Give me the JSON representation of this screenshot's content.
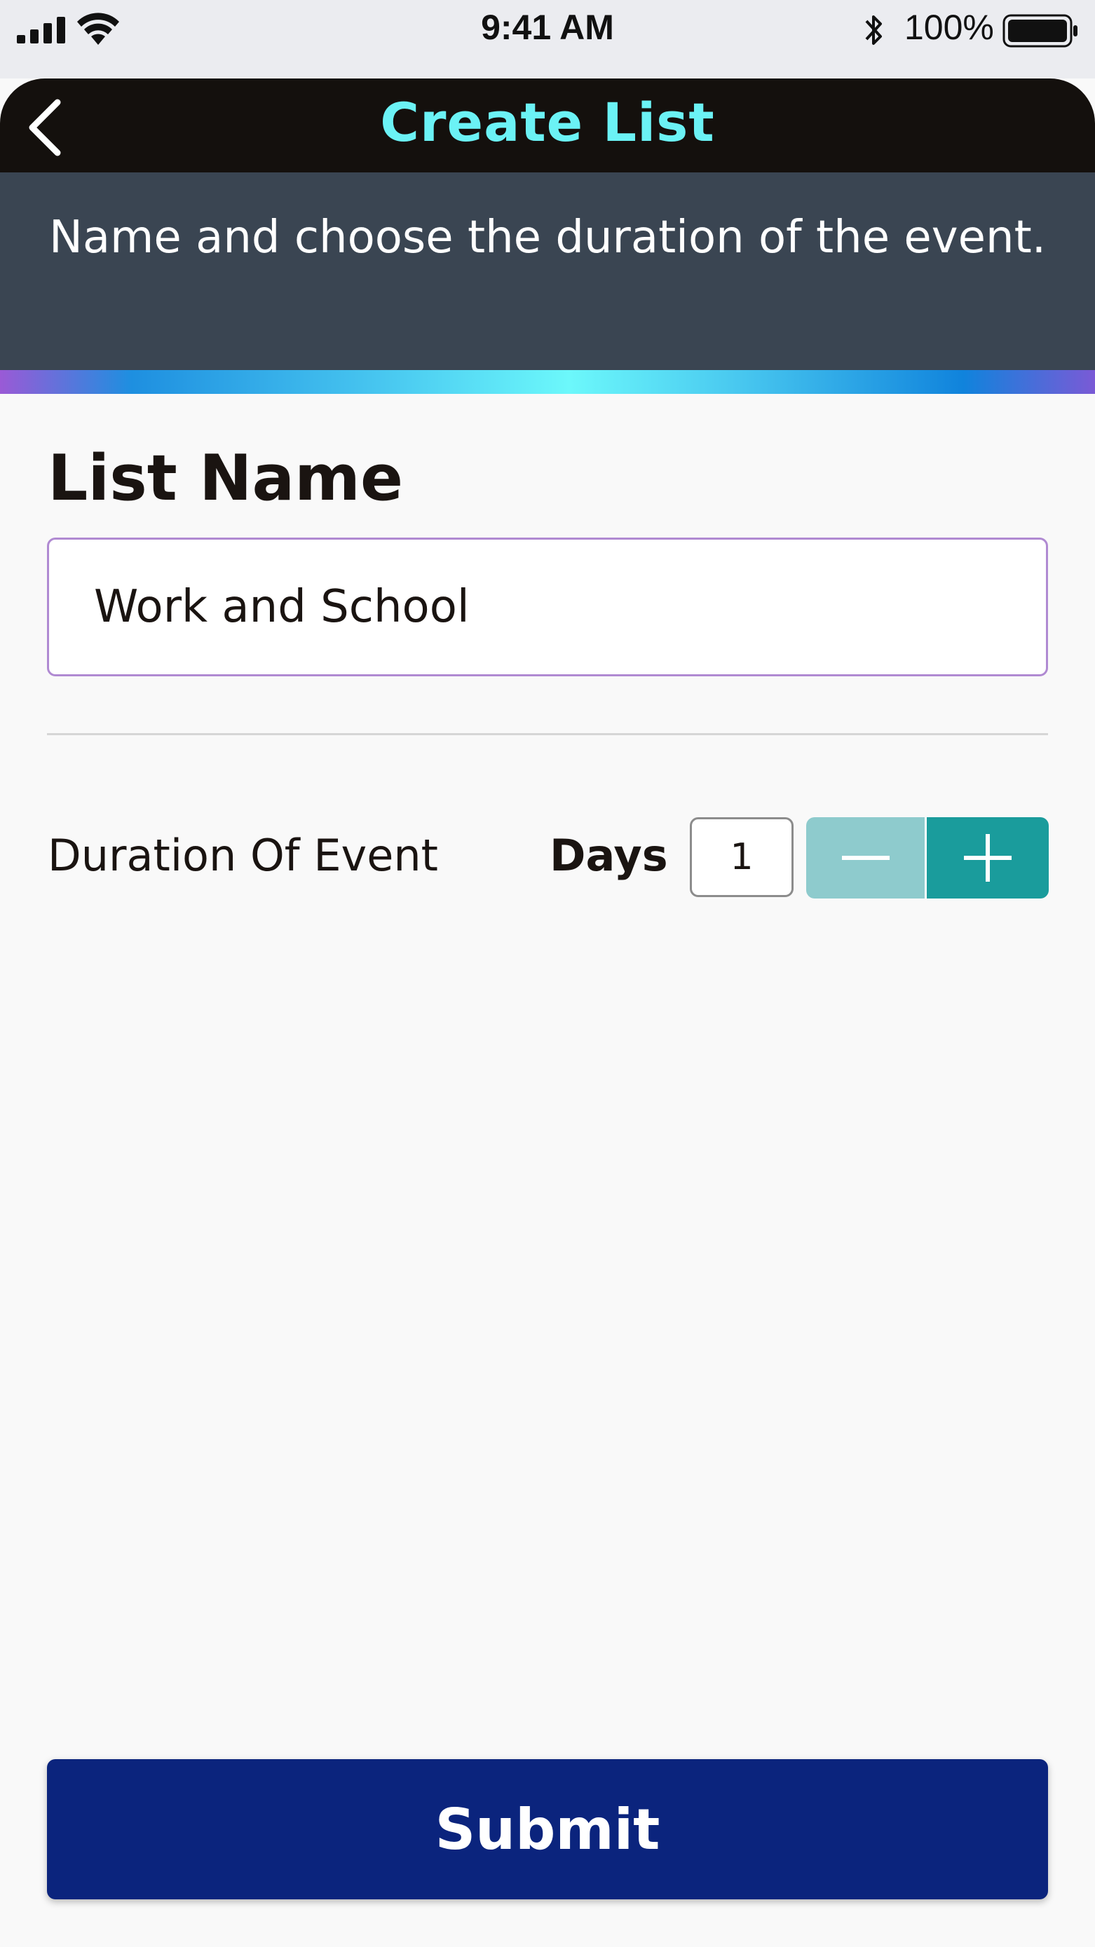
{
  "status_bar": {
    "time": "9:41 AM",
    "battery_percent": "100%",
    "icons": [
      "signal-icon",
      "wifi-icon",
      "bluetooth-icon",
      "battery-icon"
    ]
  },
  "header": {
    "title": "Create List",
    "back_icon": "chevron-left-icon"
  },
  "instruction": {
    "text": "Name and choose the duration of the event."
  },
  "form": {
    "list_name_label": "List Name",
    "list_name_value": "Work and School",
    "duration_label": "Duration Of Event",
    "days_label": "Days",
    "days_value": "1",
    "decrement_icon": "minus-icon",
    "increment_icon": "plus-icon"
  },
  "actions": {
    "submit_label": "Submit"
  },
  "colors": {
    "header_bg": "#14100d",
    "title": "#6bf2f5",
    "band_bg": "#3a4552",
    "input_border": "#b08ad2",
    "stepper_minus": "#8ecbcd",
    "stepper_plus": "#1a9c9c",
    "submit_bg": "#0b247d"
  }
}
